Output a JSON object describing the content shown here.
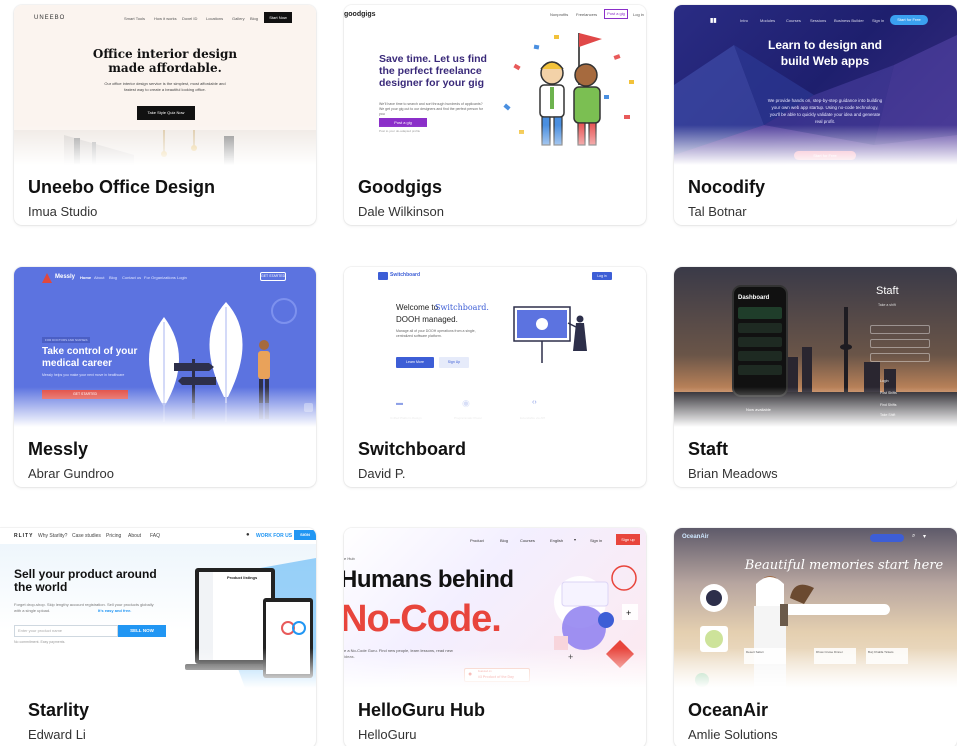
{
  "cards": [
    {
      "title": "Uneebo Office Design",
      "author": "Imua Studio",
      "thumb": {
        "logo": "UNEEBO",
        "nav": [
          "Smart Tools",
          "How it works",
          "Doxel ID",
          "Locations",
          "Gallery",
          "Blog"
        ],
        "nav_cta": "Start Now",
        "headline": "Office interior design made affordable.",
        "body": "Our office interior design service is the simplest, most affordable and fastest way to create a beautiful looking office.",
        "cta": "Take Style Quiz Now"
      }
    },
    {
      "title": "Goodgigs",
      "author": "Dale Wilkinson",
      "thumb": {
        "logo": "goodgigs",
        "nav": [
          "Nonprofits",
          "Freelancers"
        ],
        "nav_cta": "Post a gig",
        "nav_login": "Log in",
        "headline": "Save time. Let us find the perfect freelance designer for your gig",
        "body": "We'll have time to search and sort through hundreds of applicants? We get your gig out to our designers and find the perfect person for you",
        "cta": "Post a gig",
        "footnote": "Post to your do-adapted profile"
      }
    },
    {
      "title": "Nocodify",
      "author": "Tal Botnar",
      "thumb": {
        "nav": [
          "Intro",
          "Modules",
          "Courses",
          "Sessions",
          "Business Builder",
          "Sign in"
        ],
        "nav_cta": "Start for Free",
        "headline": "Learn to design and build Web apps",
        "body": "We provide hands on, step-by-step guidance into building your own web app startup. Using no-code technology, you'll be able to quickly validate your idea and generate real profit.",
        "cta": "Start for Free"
      }
    },
    {
      "title": "Messly",
      "author": "Abrar Gundroo",
      "thumb": {
        "logo": "Messly",
        "nav": [
          "Home",
          "About",
          "Blog",
          "Contact us",
          "For Organizations",
          "Login"
        ],
        "nav_cta": "GET STARTED",
        "tag": "FOR DOCTORS AND NURSES",
        "headline": "Take control of your medical career",
        "body": "Messly helps you make your next move in healthcare",
        "cta": "GET STARTED"
      }
    },
    {
      "title": "Switchboard",
      "author": "David P.",
      "thumb": {
        "logo": "Switchboard",
        "nav_cta": "Log in",
        "headline_1": "Welcome to",
        "headline_brand": "Switchboard.",
        "headline_2": "DOOH managed.",
        "body": "Manage all of your DOOH operations from a single, centralized software platform.",
        "btn_primary": "Learn More",
        "btn_secondary": "Sign Up",
        "features": [
          "Unified Platform Design",
          "Programmatic Power",
          "Extendable via API"
        ]
      }
    },
    {
      "title": "Staft",
      "author": "Brian Meadows",
      "thumb": {
        "phone_title": "Dashboard",
        "phone_caption": "Now available",
        "brand": "Staft",
        "subtitle": "Take a shift",
        "menu": [
          "Login",
          "Post Shifts",
          "Find Shifts",
          "Take Shift",
          "Terms and Policies"
        ]
      }
    },
    {
      "title": "Starlity",
      "author": "Edward Li",
      "thumb": {
        "logo": "RLITY",
        "nav": [
          "Why Starlity?",
          "Case studies",
          "Pricing",
          "About",
          "FAQ"
        ],
        "nav_right": "WORK FOR US",
        "nav_cta": "SIGN",
        "headline": "Sell your product around the world",
        "body": "Forget drop-shop. Skip lengthy account registration. Sell your products globally with a single upload.",
        "body_highlight": "It's easy and free.",
        "input_placeholder": "Enter your product name",
        "cta": "SELL NOW",
        "footnote": "No commitment. Easy payments.",
        "panel_title": "Product listings"
      }
    },
    {
      "title": "HelloGuru Hub",
      "author": "HelloGuru",
      "thumb": {
        "nav": [
          "Product",
          "Blog",
          "Courses",
          "English",
          "Sign in"
        ],
        "nav_cta": "Sign up",
        "crumb": "e Hub",
        "headline_1": "Humans behind",
        "headline_2": "No-Code.",
        "body": "e a No-Code Guru. Find new people, learn lessons, read new ideas.",
        "badge_top": "Featured on",
        "badge_main": "#3 Product of the Day"
      }
    },
    {
      "title": "OceanAir",
      "author": "Amlie Solutions",
      "thumb": {
        "logo": "OceanAir",
        "headline": "Beautiful memories start here",
        "search_placeholder": "Search",
        "tiles": [
          "Desert Safari",
          "Dhow Cruise Dinner",
          "Burj Khalifa Tickets"
        ]
      }
    }
  ],
  "colors": {
    "uneebo_bg": "#fbf4ef",
    "goodgigs_purple": "#8b2fc9",
    "nocodify_navy": "#1e1f6e",
    "messly_blue": "#5c73e0",
    "messly_red": "#e0483f",
    "switchboard_blue": "#3d5ed6",
    "staft_dark": "#2a2a33",
    "starlity_blue": "#2196f3",
    "helloguru_red": "#e8453c",
    "oceanair_sand": "#e4cfb0"
  }
}
